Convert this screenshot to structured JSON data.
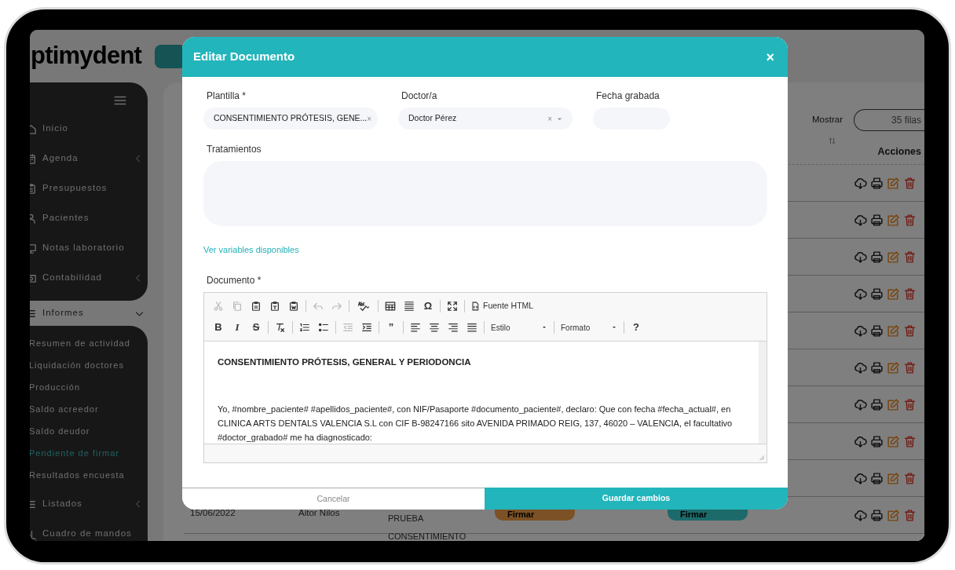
{
  "app": {
    "logo": "ptimydent",
    "sidebar": {
      "items": [
        {
          "label": "Inicio",
          "kind": "home",
          "collapsible": false
        },
        {
          "label": "Agenda",
          "kind": "calendar",
          "collapsible": true
        },
        {
          "label": "Presupuestos",
          "kind": "clipboard",
          "collapsible": false
        },
        {
          "label": "Pacientes",
          "kind": "user",
          "collapsible": false
        },
        {
          "label": "Notas laboratorio",
          "kind": "monitor",
          "collapsible": false
        },
        {
          "label": "Contabilidad",
          "kind": "cash",
          "collapsible": true
        }
      ],
      "section": {
        "label": "Informes",
        "expanded": true,
        "children": [
          {
            "label": "Resumen de actividad",
            "selected": false
          },
          {
            "label": "Liquidación doctores",
            "selected": false
          },
          {
            "label": "Producción",
            "selected": false
          },
          {
            "label": "Saldo acreedor",
            "selected": false
          },
          {
            "label": "Saldo deudor",
            "selected": false
          },
          {
            "label": "Pendiente de firmar",
            "selected": true
          },
          {
            "label": "Resultados encuesta",
            "selected": false
          }
        ]
      },
      "bottom_items": [
        {
          "label": "Listados",
          "kind": "list",
          "collapsible": true
        },
        {
          "label": "Cuadro de mandos",
          "kind": "chart",
          "collapsible": false
        }
      ]
    },
    "table": {
      "show_label": "Mostrar",
      "rows_select": "35 filas",
      "columns": [
        "Acciones"
      ],
      "rows": [
        {
          "actions": true
        },
        {
          "actions": true
        },
        {
          "actions": true
        },
        {
          "actions": true
        },
        {
          "actions": true
        },
        {
          "actions": true
        },
        {
          "actions": true
        },
        {
          "actions": true
        },
        {
          "actions": true
        },
        {
          "actions": true,
          "date": "15/06/2022",
          "doctor": "Aitor Nilos",
          "document": "PRUEBA",
          "sign_buttons": [
            {
              "label": "Firmar",
              "color": "#7c5125"
            },
            {
              "label": "Firmar",
              "color": "#1d6a6b"
            }
          ]
        },
        {
          "actions": false,
          "document": "CONSENTIMIENTO"
        }
      ]
    }
  },
  "modal": {
    "title": "Editar Documento",
    "close": "×",
    "fields": [
      {
        "label": "Plantilla *",
        "value": "CONSENTIMIENTO PRÓTESIS, GENE...",
        "clear": "×",
        "kind": "select"
      },
      {
        "label": "Doctor/a",
        "value": "Doctor Pérez",
        "clear": "×",
        "kind": "select"
      },
      {
        "label": "Fecha grabada",
        "kind": "date"
      }
    ],
    "treatments_label": "Tratamientos",
    "variables_link": "Ver variables disponibles",
    "document_label": "Documento *",
    "editor": {
      "toolbar": [
        [
          [
            {
              "kind": "cut",
              "disabled": true
            },
            {
              "kind": "copy",
              "disabled": true
            },
            {
              "kind": "paste",
              "disabled": false
            },
            {
              "kind": "paste-text",
              "disabled": false
            },
            {
              "kind": "paste-word",
              "disabled": false
            }
          ],
          [
            {
              "kind": "undo",
              "disabled": true
            },
            {
              "kind": "redo",
              "disabled": true
            }
          ],
          [
            {
              "kind": "spellcheck",
              "disabled": false
            }
          ],
          [
            {
              "kind": "table",
              "disabled": false
            },
            {
              "kind": "hline",
              "disabled": false
            },
            {
              "kind": "glyph",
              "label": "Ω",
              "disabled": false
            }
          ],
          [
            {
              "kind": "maximize",
              "disabled": false
            }
          ],
          [
            {
              "kind": "source",
              "label": "Fuente HTML",
              "disabled": false
            }
          ]
        ],
        [
          [
            {
              "kind": "glyph",
              "label": "B",
              "disabled": false
            },
            {
              "kind": "glyph-italic",
              "label": "I",
              "disabled": false
            },
            {
              "kind": "glyph-strike",
              "label": "S",
              "disabled": false
            }
          ],
          [
            {
              "kind": "remove-format",
              "disabled": false
            }
          ],
          [
            {
              "kind": "ol",
              "disabled": false
            },
            {
              "kind": "ul",
              "disabled": false
            }
          ],
          [
            {
              "kind": "outdent",
              "disabled": true
            },
            {
              "kind": "indent",
              "disabled": false
            }
          ],
          [
            {
              "kind": "glyph",
              "label": "”",
              "disabled": false
            }
          ],
          [
            {
              "kind": "align-left",
              "disabled": false
            },
            {
              "kind": "align-center",
              "disabled": false
            },
            {
              "kind": "align-right",
              "disabled": false
            },
            {
              "kind": "justify",
              "disabled": false
            }
          ],
          [
            {
              "kind": "combo",
              "label": "Estilo",
              "disabled": false
            }
          ],
          [
            {
              "kind": "combo",
              "label": "Formato",
              "disabled": false
            }
          ],
          [
            {
              "kind": "glyph",
              "label": "?",
              "disabled": false
            }
          ]
        ]
      ],
      "heading": "CONSENTIMIENTO PRÓTESIS, GENERAL Y PERIODONCIA",
      "paragraph": "Yo, #nombre_paciente# #apellidos_paciente#, con NIF/Pasaporte #documento_paciente#, declaro: Que con fecha #fecha_actual#, en CLINICA ARTS DENTALS VALENCIA S.L con CIF B-98247166 sito AVENIDA PRIMADO REIG, 137, 46020 – VALENCIA, el facultativo #doctor_grabado# me ha diagnosticado:"
    },
    "cancel": "Cancelar",
    "save": "Guardar cambios"
  }
}
